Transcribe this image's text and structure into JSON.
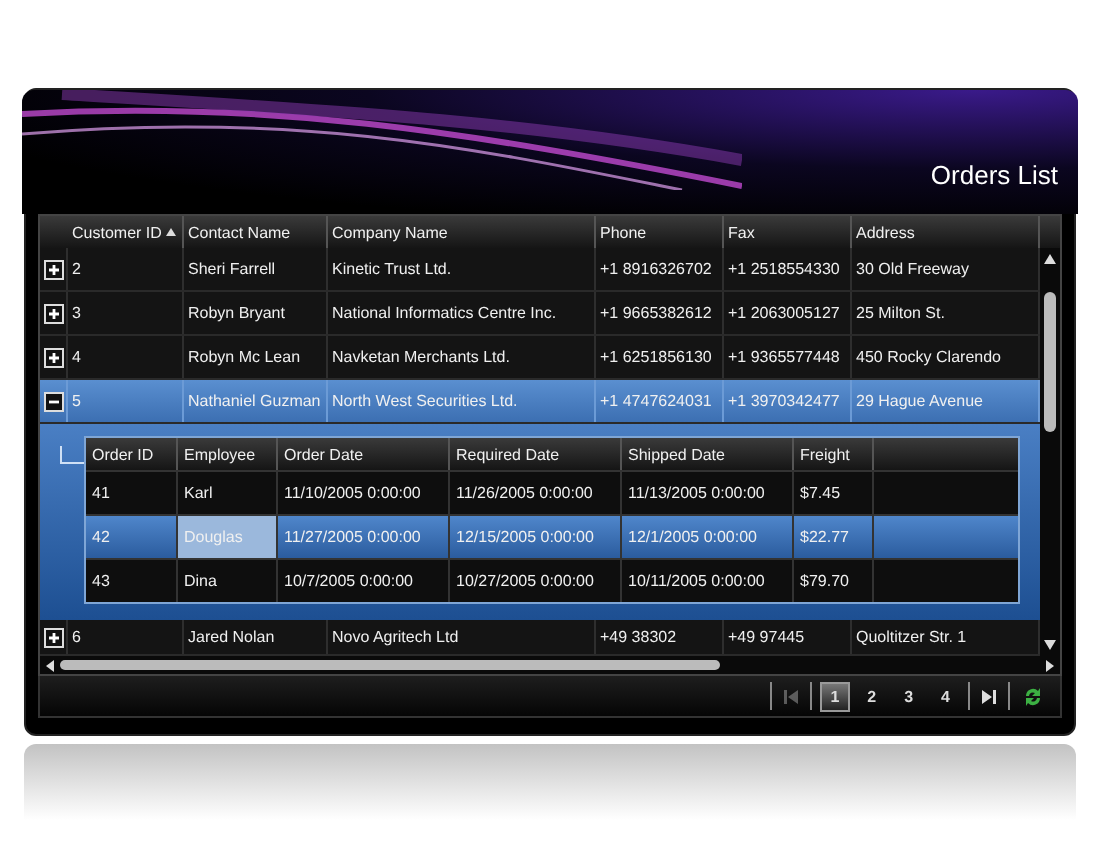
{
  "window": {
    "title": "Orders List"
  },
  "grid": {
    "columns": [
      {
        "label": "Customer ID",
        "sorted": true
      },
      {
        "label": "Contact Name",
        "sorted": false
      },
      {
        "label": "Company Name",
        "sorted": false
      },
      {
        "label": "Phone",
        "sorted": false
      },
      {
        "label": "Fax",
        "sorted": false
      },
      {
        "label": "Address",
        "sorted": false
      }
    ],
    "rows": [
      {
        "cells": [
          "2",
          "Sheri Farrell",
          "Kinetic Trust Ltd.",
          "+1 8916326702",
          "+1 2518554330",
          "30 Old Freeway"
        ],
        "expanded": false,
        "selected": false
      },
      {
        "cells": [
          "3",
          "Robyn Bryant",
          "National Informatics Centre Inc.",
          "+1 9665382612",
          "+1 2063005127",
          "25 Milton St."
        ],
        "expanded": false,
        "selected": false
      },
      {
        "cells": [
          "4",
          "Robyn Mc Lean",
          "Navketan Merchants Ltd.",
          "+1 6251856130",
          "+1 9365577448",
          "450 Rocky Clarendo"
        ],
        "expanded": false,
        "selected": false
      },
      {
        "cells": [
          "5",
          "Nathaniel Guzman",
          "North West Securities Ltd.",
          "+1 4747624031",
          "+1 3970342477",
          "29 Hague Avenue"
        ],
        "expanded": true,
        "selected": true,
        "details": {
          "columns": [
            "Order ID",
            "Employee",
            "Order Date",
            "Required Date",
            "Shipped Date",
            "Freight"
          ],
          "rows": [
            {
              "cells": [
                {
                  "text": "41",
                  "focused": false
                },
                {
                  "text": "Karl",
                  "focused": false
                },
                {
                  "text": "11/10/2005 0:00:00",
                  "focused": false
                },
                {
                  "text": "11/26/2005 0:00:00",
                  "focused": false
                },
                {
                  "text": "11/13/2005 0:00:00",
                  "focused": false
                },
                {
                  "text": "$7.45",
                  "focused": false
                }
              ],
              "selected": false
            },
            {
              "cells": [
                {
                  "text": "42",
                  "focused": false
                },
                {
                  "text": "Douglas",
                  "focused": true
                },
                {
                  "text": "11/27/2005 0:00:00",
                  "focused": false
                },
                {
                  "text": "12/15/2005 0:00:00",
                  "focused": false
                },
                {
                  "text": "12/1/2005 0:00:00",
                  "focused": false
                },
                {
                  "text": "$22.77",
                  "focused": false
                }
              ],
              "selected": true
            },
            {
              "cells": [
                {
                  "text": "43",
                  "focused": false
                },
                {
                  "text": "Dina",
                  "focused": false
                },
                {
                  "text": "10/7/2005 0:00:00",
                  "focused": false
                },
                {
                  "text": "10/27/2005 0:00:00",
                  "focused": false
                },
                {
                  "text": "10/11/2005 0:00:00",
                  "focused": false
                },
                {
                  "text": "$79.70",
                  "focused": false
                }
              ],
              "selected": false
            }
          ]
        }
      },
      {
        "cells": [
          "6",
          "Jared Nolan",
          "Novo Agritech Ltd",
          "+49 38302",
          "+49 97445",
          "Quoltitzer Str. 1"
        ],
        "expanded": false,
        "selected": false
      }
    ]
  },
  "pager": {
    "first_disabled": true,
    "pages": [
      {
        "label": "1",
        "selected": true
      },
      {
        "label": "2",
        "selected": false
      },
      {
        "label": "3",
        "selected": false
      },
      {
        "label": "4",
        "selected": false
      }
    ],
    "last_disabled": false
  }
}
